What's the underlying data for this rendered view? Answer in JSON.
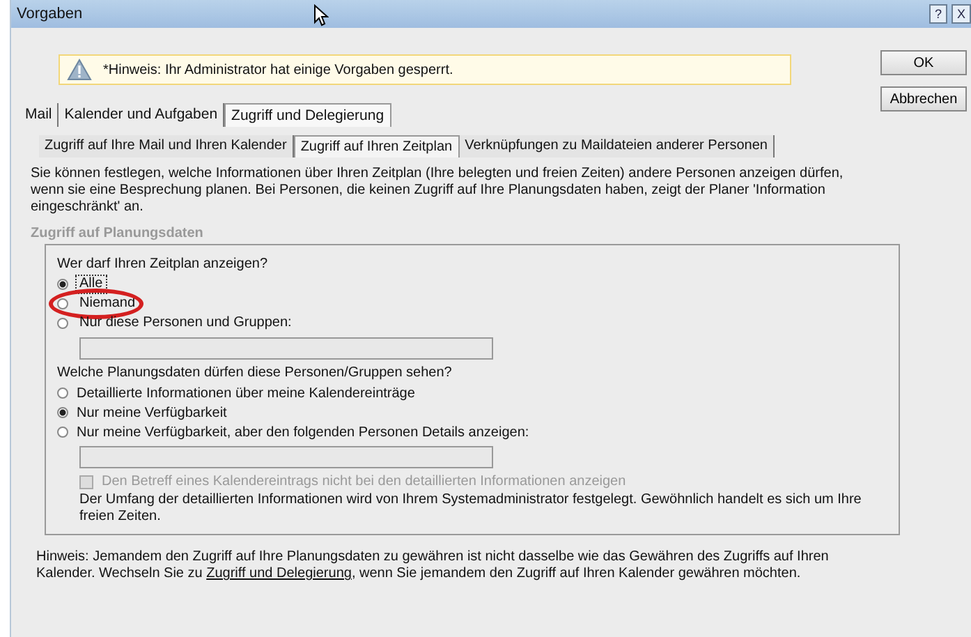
{
  "window": {
    "title": "Vorgaben",
    "help_button": "?",
    "close_button": "X"
  },
  "notice": "*Hinweis: Ihr Administrator hat einige Vorgaben gesperrt.",
  "buttons": [
    "OK",
    "Abbrechen"
  ],
  "tabs": [
    {
      "label": "Mail",
      "selected": false
    },
    {
      "label": "Kalender und Aufgaben",
      "selected": false
    },
    {
      "label": "Zugriff und Delegierung",
      "selected": true
    }
  ],
  "subtabs": [
    {
      "label": "Zugriff auf Ihre Mail und Ihren Kalender",
      "selected": false
    },
    {
      "label": "Zugriff auf Ihren Zeitplan",
      "selected": true
    },
    {
      "label": "Verknüpfungen zu Maildateien anderer Personen",
      "selected": false
    }
  ],
  "description": "Sie können festlegen, welche Informationen über Ihren Zeitplan (Ihre belegten und freien Zeiten) andere Personen anzeigen dürfen, wenn sie eine Besprechung planen. Bei Personen, die keinen Zugriff auf Ihre Planungsdaten haben, zeigt der Planer 'Information eingeschränkt' an.",
  "group": {
    "title": "Zugriff auf Planungsdaten",
    "question_1": "Wer darf Ihren Zeitplan anzeigen?",
    "who": [
      {
        "label": "Alle",
        "selected": true,
        "highlighted": false
      },
      {
        "label": "Niemand",
        "selected": false,
        "highlighted": true
      },
      {
        "label": "Nur diese Personen und Gruppen:",
        "selected": false,
        "highlighted": false
      }
    ],
    "question_2": "Welche Planungsdaten dürfen diese Personen/Gruppen sehen?",
    "what": [
      {
        "label": "Detaillierte Informationen über meine Kalendereinträge",
        "selected": false
      },
      {
        "label": "Nur meine Verfügbarkeit",
        "selected": true
      },
      {
        "label": "Nur meine Verfügbarkeit, aber den folgenden Personen Details anzeigen:",
        "selected": false
      }
    ],
    "checkbox": {
      "label": "Den Betreff eines Kalendereintrags nicht bei den detaillierten Informationen anzeigen",
      "checked": false,
      "disabled": true
    },
    "info": "Der Umfang der detaillierten Informationen wird von Ihrem Systemadministrator festgelegt. Gewöhnlich handelt es sich um Ihre freien Zeiten."
  },
  "hint_before": "Hinweis: Jemandem den Zugriff auf Ihre Planungsdaten zu gewähren ist nicht dasselbe wie das Gewähren des Zugriffs auf Ihren Kalender. Wechseln Sie zu",
  "hint_link": "Zugriff und Delegierung",
  "hint_after": ", wenn Sie jemandem den Zugriff auf Ihren Kalender gewähren möchten."
}
